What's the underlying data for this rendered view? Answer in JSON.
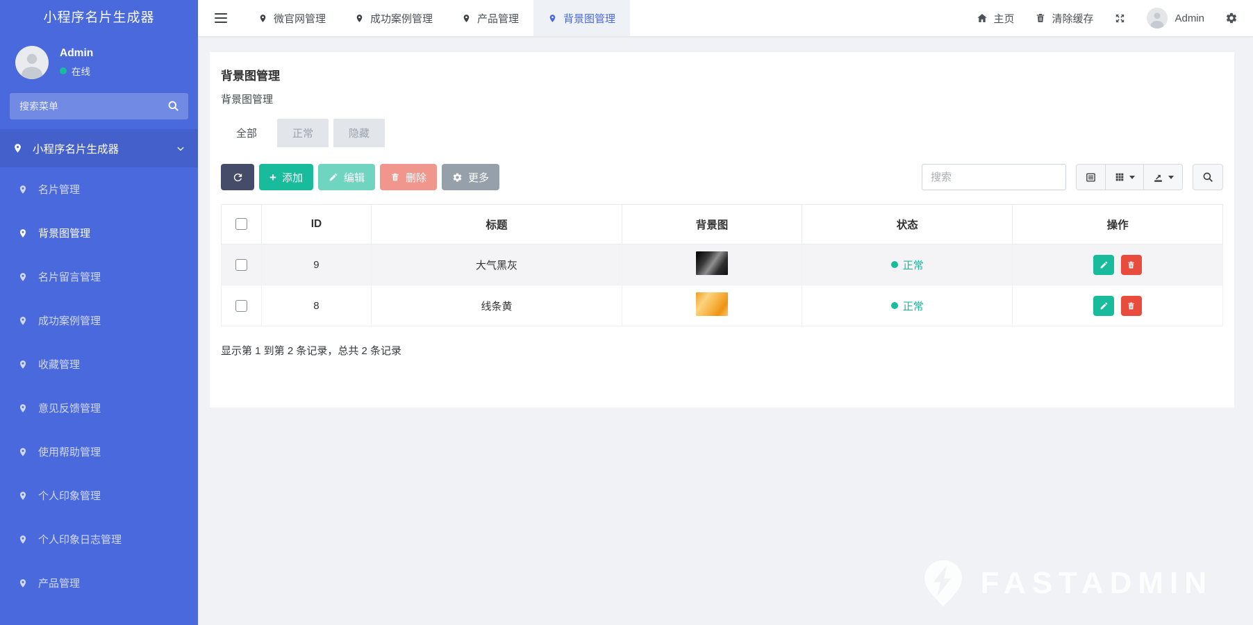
{
  "app": {
    "brand": "小程序名片生成器"
  },
  "colors": {
    "sidebar_bg": "#4a69dd",
    "accent_blue": "#4a69dd",
    "success_green": "#18bc9c",
    "danger_red": "#e74c3c",
    "dark_button": "#444c69",
    "gray_button": "#95a0aa",
    "body_bg": "#f0f2f5"
  },
  "sidebar": {
    "user": {
      "name": "Admin",
      "status": "在线"
    },
    "search_placeholder": "搜索菜单",
    "parent_label": "小程序名片生成器",
    "menu": [
      {
        "label": "名片管理",
        "active": false
      },
      {
        "label": "背景图管理",
        "active": true
      },
      {
        "label": "名片留言管理",
        "active": false
      },
      {
        "label": "成功案例管理",
        "active": false
      },
      {
        "label": "收藏管理",
        "active": false
      },
      {
        "label": "意见反馈管理",
        "active": false
      },
      {
        "label": "使用帮助管理",
        "active": false
      },
      {
        "label": "个人印象管理",
        "active": false
      },
      {
        "label": "个人印象日志管理",
        "active": false
      },
      {
        "label": "产品管理",
        "active": false
      }
    ]
  },
  "topnav": {
    "tabs": [
      {
        "label": "微官网管理",
        "active": false
      },
      {
        "label": "成功案例管理",
        "active": false
      },
      {
        "label": "产品管理",
        "active": false
      },
      {
        "label": "背景图管理",
        "active": true
      }
    ],
    "home_label": "主页",
    "clear_cache_label": "清除缓存",
    "user_name": "Admin"
  },
  "page": {
    "title": "背景图管理",
    "subtitle": "背景图管理",
    "filter_tabs": [
      {
        "label": "全部",
        "active": true
      },
      {
        "label": "正常",
        "active": false
      },
      {
        "label": "隐藏",
        "active": false
      }
    ],
    "toolbar": {
      "add_label": "添加",
      "edit_label": "编辑",
      "delete_label": "删除",
      "more_label": "更多",
      "search_placeholder": "搜索"
    },
    "table": {
      "columns": {
        "id": "ID",
        "title": "标题",
        "image": "背景图",
        "status": "状态",
        "ops": "操作"
      },
      "rows": [
        {
          "id": "9",
          "title": "大气黑灰",
          "status": "正常",
          "thumb_css": "linear-gradient(125deg,#0b0b0b 8%,#3a3a3a 32%,#8f8f8f 52%,#2d2d2d 74%,#101010 100%)"
        },
        {
          "id": "8",
          "title": "线条黄",
          "status": "正常",
          "thumb_css": "linear-gradient(125deg,#f29d1e 0%,#fcd37f 28%,#f7b84b 52%,#ef9412 78%,#fbc768 100%)"
        }
      ]
    },
    "footer_summary": "显示第 1 到第 2 条记录，总共 2 条记录"
  },
  "watermark": {
    "text": "FASTADMIN"
  }
}
